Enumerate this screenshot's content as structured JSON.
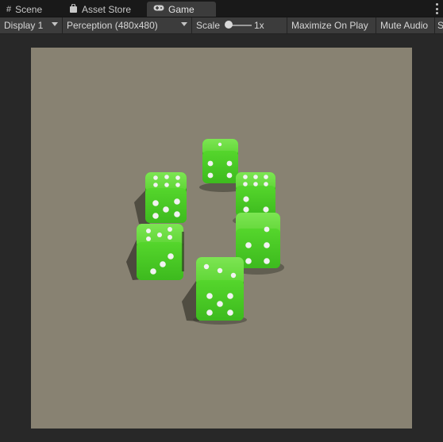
{
  "tabs": [
    {
      "label": "Scene",
      "icon": "grid-icon"
    },
    {
      "label": "Asset Store",
      "icon": "shopping-bag-icon"
    },
    {
      "label": "Game",
      "icon": "gamepad-icon"
    }
  ],
  "toolbar": {
    "display": "Display 1",
    "resolution": "Perception (480x480)",
    "scale_label": "Scale",
    "scale_value": "1x",
    "maximize": "Maximize On Play",
    "mute": "Mute Audio",
    "stats": "S"
  },
  "colors": {
    "editor_bg": "#282828",
    "viewport_bg": "#888272",
    "die_green": "#4ccf26",
    "pip": "#f2f2f2"
  }
}
